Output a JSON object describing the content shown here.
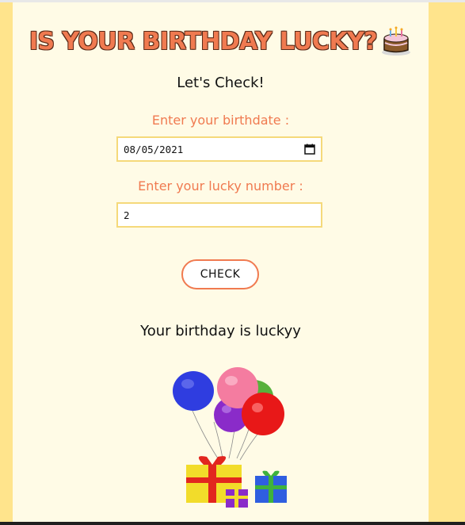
{
  "header": {
    "title": "IS YOUR BIRTHDAY LUCKY?",
    "icon": "birthday-cake-icon"
  },
  "form": {
    "subtitle": "Let's Check!",
    "birthdate_label": "Enter your birthdate :",
    "birthdate_value": "08/05/2021",
    "lucky_label": "Enter your lucky number :",
    "lucky_value": "2",
    "check_label": "CHECK"
  },
  "result": {
    "message": "Your birthday is luckyy",
    "image": "balloons-and-gifts"
  },
  "colors": {
    "accent": "#f07a50",
    "background": "#ffe48c",
    "card": "#fffbe6",
    "input_border": "#f5d97a"
  }
}
